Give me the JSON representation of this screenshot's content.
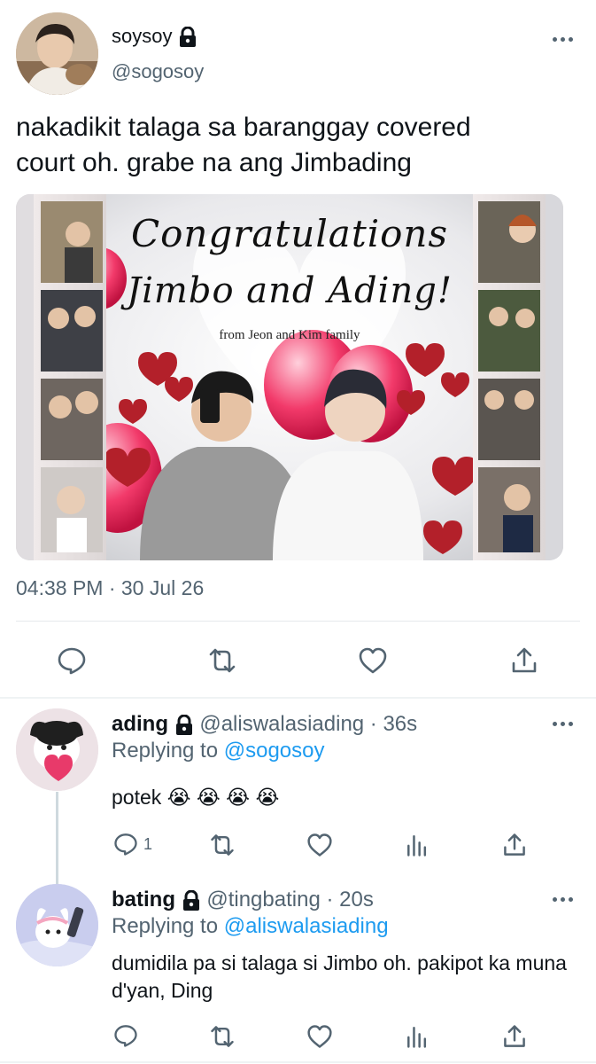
{
  "main_tweet": {
    "display_name": "soysoy",
    "handle": "@sogosoy",
    "text_line1": "nakadikit talaga sa baranggay covered",
    "text_line2": "court oh. grabe na ang Jimbading",
    "timestamp": "04:38 PM · 30 Jul 26",
    "media": {
      "title_line1": "Congratulations",
      "title_line2": "Jimbo and Ading!",
      "subtitle": "from Jeon and Kim family"
    }
  },
  "replies": [
    {
      "display_name": "ading",
      "handle_time": "@aliswalasiading · 36s",
      "replying_prefix": "Replying to",
      "replying_to": "@sogosoy",
      "text": "potek 😭 😭 😭 😭",
      "reply_count": "1"
    },
    {
      "display_name": "bating",
      "handle_time": "@tingbating · 20s",
      "replying_prefix": "Replying to",
      "replying_to": "@aliswalasiading",
      "text": "dumidila pa si talaga si Jimbo oh. pakipot ka muna d'yan, Ding"
    }
  ],
  "colors": {
    "text": "#0f1419",
    "muted": "#536471",
    "link": "#1d9bf0",
    "heart_red": "#b3202a"
  },
  "icons": [
    "lock-icon",
    "more-icon",
    "reply-icon",
    "retweet-icon",
    "like-icon",
    "share-icon",
    "analytics-icon"
  ]
}
